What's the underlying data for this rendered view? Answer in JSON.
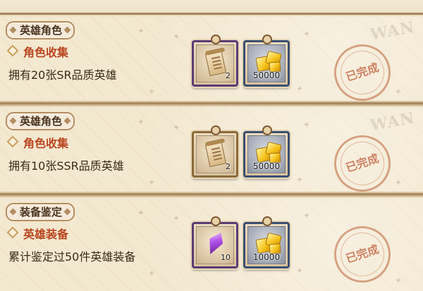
{
  "cards": [
    {
      "category": "英雄角色",
      "subtitle": "角色收集",
      "description": "拥有20张SR品质英雄",
      "status": "已完成",
      "rewards": [
        {
          "icon": "scroll-icon",
          "frame_color": "#5c3b74",
          "quantity": "2"
        },
        {
          "icon": "gold-icon",
          "frame_color": "#3a4f70",
          "quantity": "50000"
        }
      ],
      "watermark": "WAN"
    },
    {
      "category": "英雄角色",
      "subtitle": "角色收集",
      "description": "拥有10张SSR品质英雄",
      "status": "已完成",
      "rewards": [
        {
          "icon": "scroll-icon",
          "frame_color": "#8a6a3a",
          "quantity": "2"
        },
        {
          "icon": "gold-icon",
          "frame_color": "#3a4f70",
          "quantity": "50000"
        }
      ],
      "watermark": "WAN"
    },
    {
      "category": "装备鉴定",
      "subtitle": "英雄装备",
      "description": "累计鉴定过50件英雄装备",
      "status": "已完成",
      "rewards": [
        {
          "icon": "crystal-icon",
          "frame_color": "#5c3b74",
          "quantity": "10"
        },
        {
          "icon": "gold-icon",
          "frame_color": "#3a4f70",
          "quantity": "10000"
        }
      ]
    }
  ]
}
